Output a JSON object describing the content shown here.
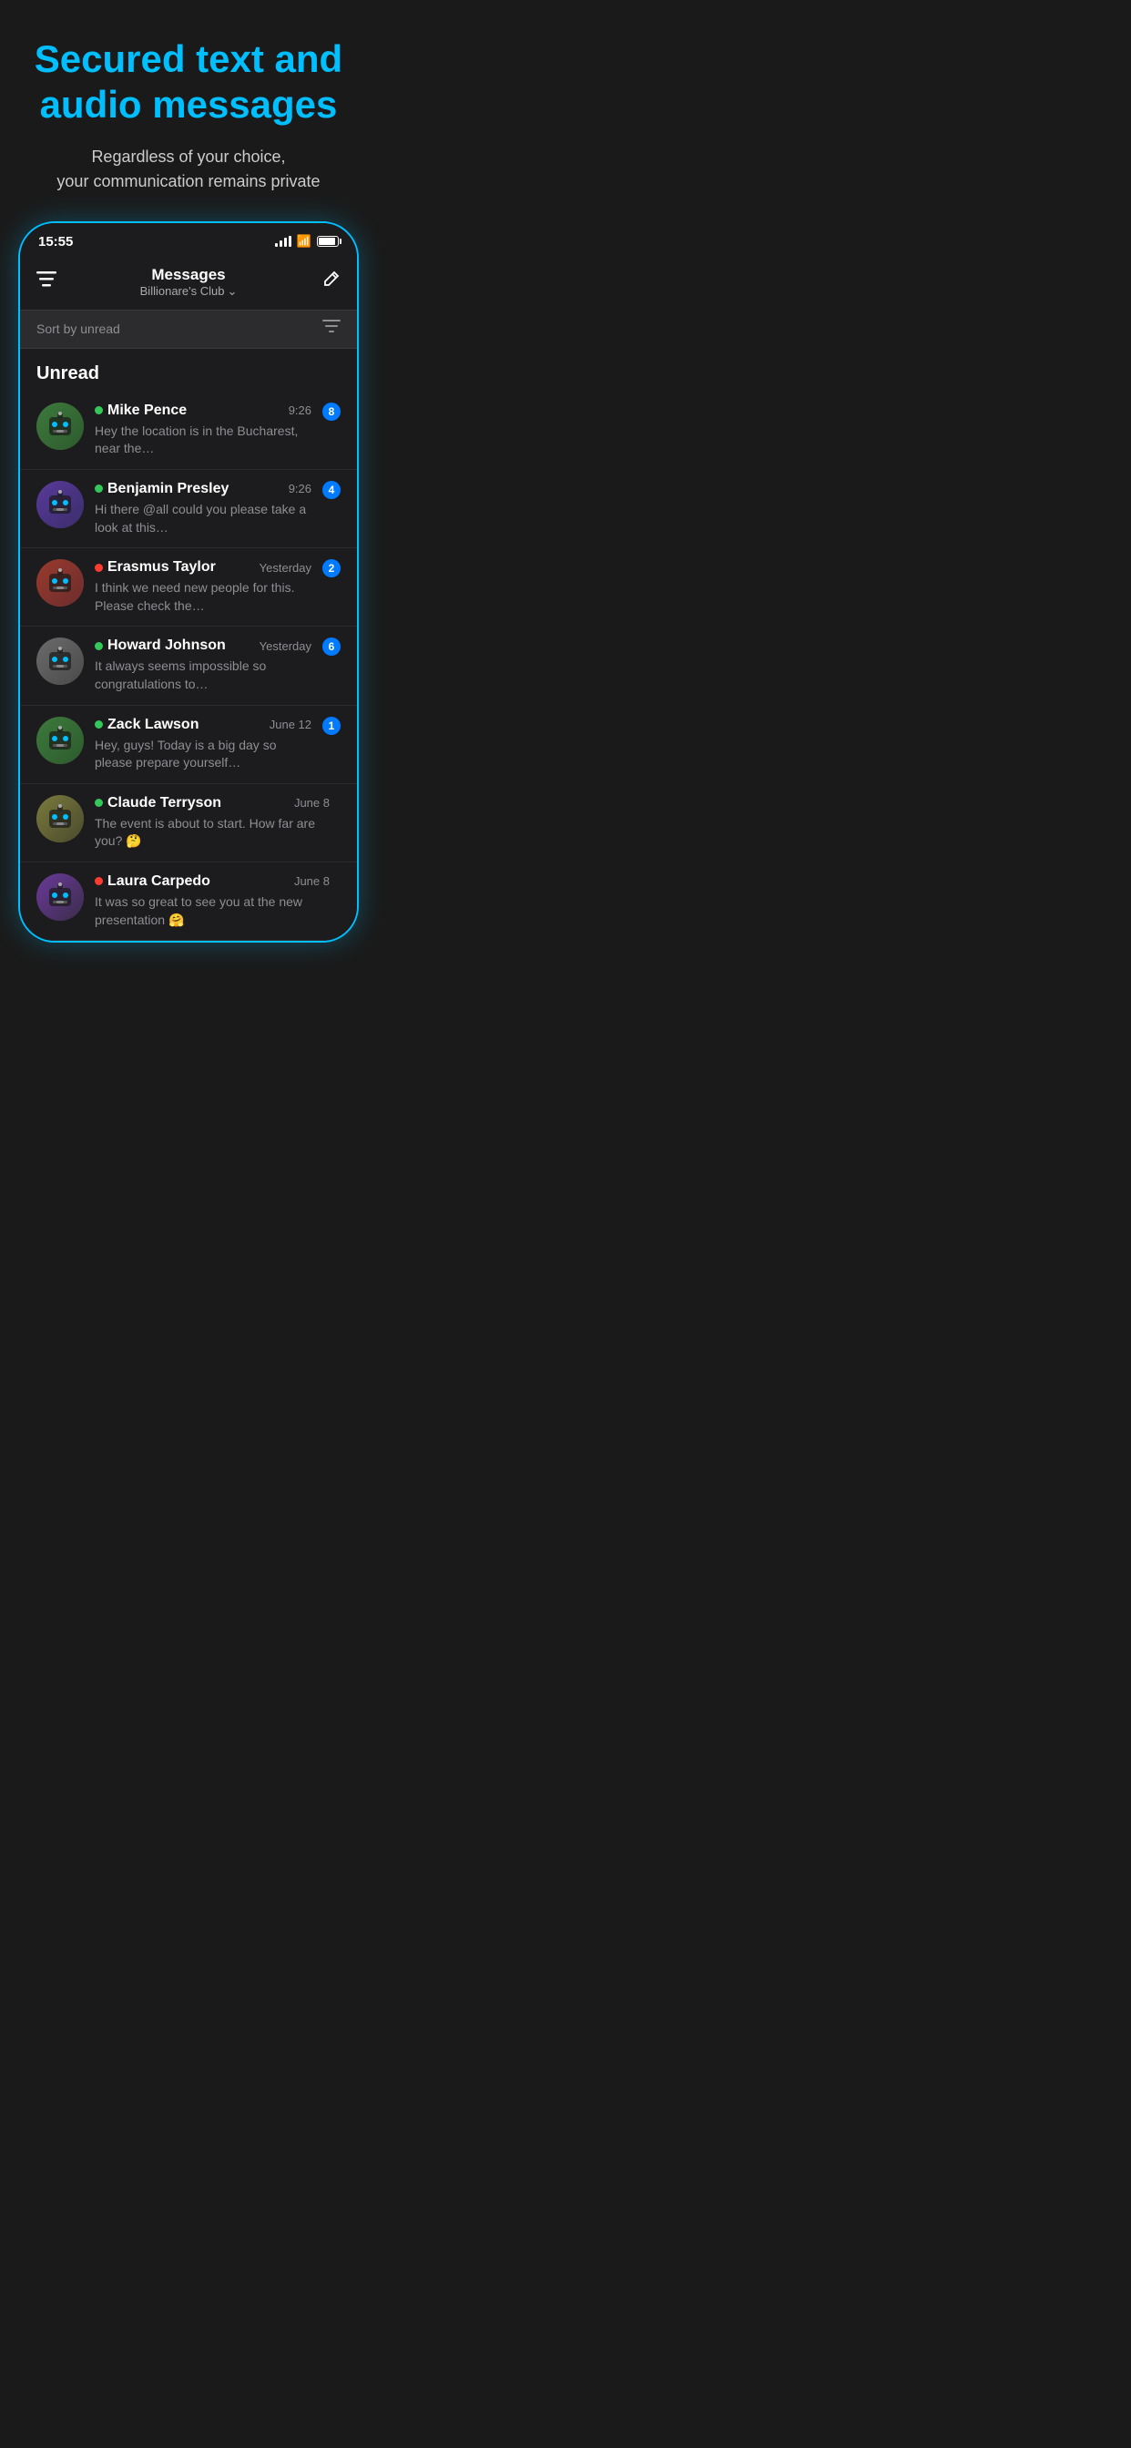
{
  "header": {
    "title_line1": "Secured text and",
    "title_line2": "audio messages",
    "subtitle_line1": "Regardless of your choice,",
    "subtitle_line2": "your communication remains private"
  },
  "status_bar": {
    "time": "15:55",
    "signal": "signal",
    "wifi": "wifi",
    "battery": "battery"
  },
  "nav": {
    "title": "Messages",
    "subtitle": "Billionare's Club",
    "filter_icon": "≡",
    "edit_icon": "✏"
  },
  "sort": {
    "label": "Sort by unread",
    "icon": "filter"
  },
  "section": {
    "unread_label": "Unread"
  },
  "messages": [
    {
      "id": 1,
      "name": "Mike Pence",
      "status": "green",
      "time": "9:26",
      "preview": "Hey the location is in the Bucharest, near the…",
      "unread": 8,
      "avatar_class": "av-1"
    },
    {
      "id": 2,
      "name": "Benjamin Presley",
      "status": "green",
      "time": "9:26",
      "preview": "Hi there @all could you please take a look at this…",
      "unread": 4,
      "avatar_class": "av-2"
    },
    {
      "id": 3,
      "name": "Erasmus Taylor",
      "status": "red",
      "time": "Yesterday",
      "preview": "I think we need new people for this. Please check the…",
      "unread": 2,
      "avatar_class": "av-3"
    },
    {
      "id": 4,
      "name": "Howard Johnson",
      "status": "green",
      "time": "Yesterday",
      "preview": "It always seems impossible so congratulations to…",
      "unread": 6,
      "avatar_class": "av-4"
    },
    {
      "id": 5,
      "name": "Zack Lawson",
      "status": "green",
      "time": "June 12",
      "preview": "Hey, guys! Today is a big day so please prepare yourself…",
      "unread": 1,
      "avatar_class": "av-5"
    },
    {
      "id": 6,
      "name": "Claude Terryson",
      "status": "green",
      "time": "June 8",
      "preview": "The event is about to start. How far are you? 🤔",
      "unread": 0,
      "avatar_class": "av-6"
    },
    {
      "id": 7,
      "name": "Laura Carpedo",
      "status": "red",
      "time": "June 8",
      "preview": "It was so great to see you at the new presentation 🤗",
      "unread": 0,
      "avatar_class": "av-7"
    }
  ]
}
